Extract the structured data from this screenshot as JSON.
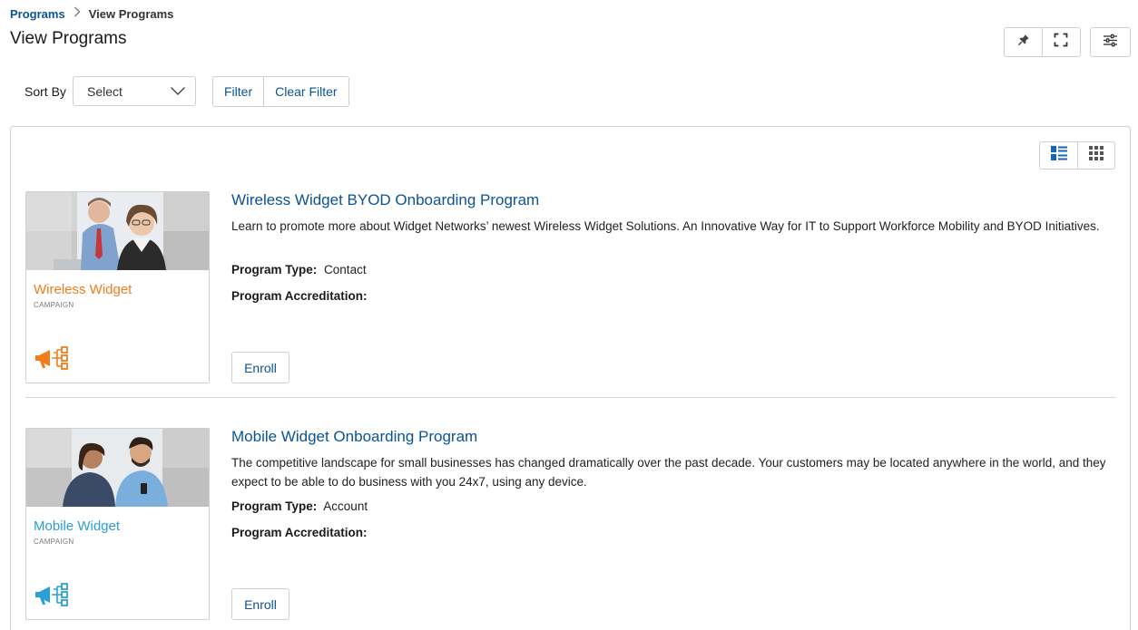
{
  "breadcrumb": {
    "root": "Programs",
    "current": "View Programs"
  },
  "page": {
    "title": "View Programs"
  },
  "toolbar": {
    "pin_icon": "pin-icon",
    "fullscreen_icon": "fullscreen-icon",
    "settings_icon": "sliders-icon"
  },
  "sort": {
    "label": "Sort By",
    "value": "Select"
  },
  "filter": {
    "filter_label": "Filter",
    "clear_label": "Clear Filter"
  },
  "view_toggle": {
    "active": "list",
    "list_icon": "list-view-icon",
    "grid_icon": "grid-view-icon"
  },
  "colors": {
    "link": "#0b5394",
    "orange": "#f07d1d",
    "blue": "#2a9fd8"
  },
  "programs": [
    {
      "title": "Wireless Widget BYOD Onboarding Program",
      "description": "Learn to promote more about Widget Networks’ newest Wireless Widget Solutions. An Innovative Way for IT to Support Workforce Mobility and BYOD Initiatives.",
      "type_label": "Program Type:",
      "type_value": "Contact",
      "accreditation_label": "Program Accreditation:",
      "accreditation_value": "",
      "thumb_brand": "Wireless Widget",
      "thumb_kind": "CAMPAIGN",
      "enroll_label": "Enroll"
    },
    {
      "title": "Mobile Widget Onboarding Program",
      "description": "The competitive landscape for small businesses has changed dramatically over the past decade. Your customers may be located anywhere in the world, and they expect to be able to do business with you 24x7, using any device.",
      "type_label": "Program Type:",
      "type_value": "Account",
      "accreditation_label": "Program Accreditation:",
      "accreditation_value": "",
      "thumb_brand": "Mobile Widget",
      "thumb_kind": "CAMPAIGN",
      "enroll_label": "Enroll"
    }
  ]
}
